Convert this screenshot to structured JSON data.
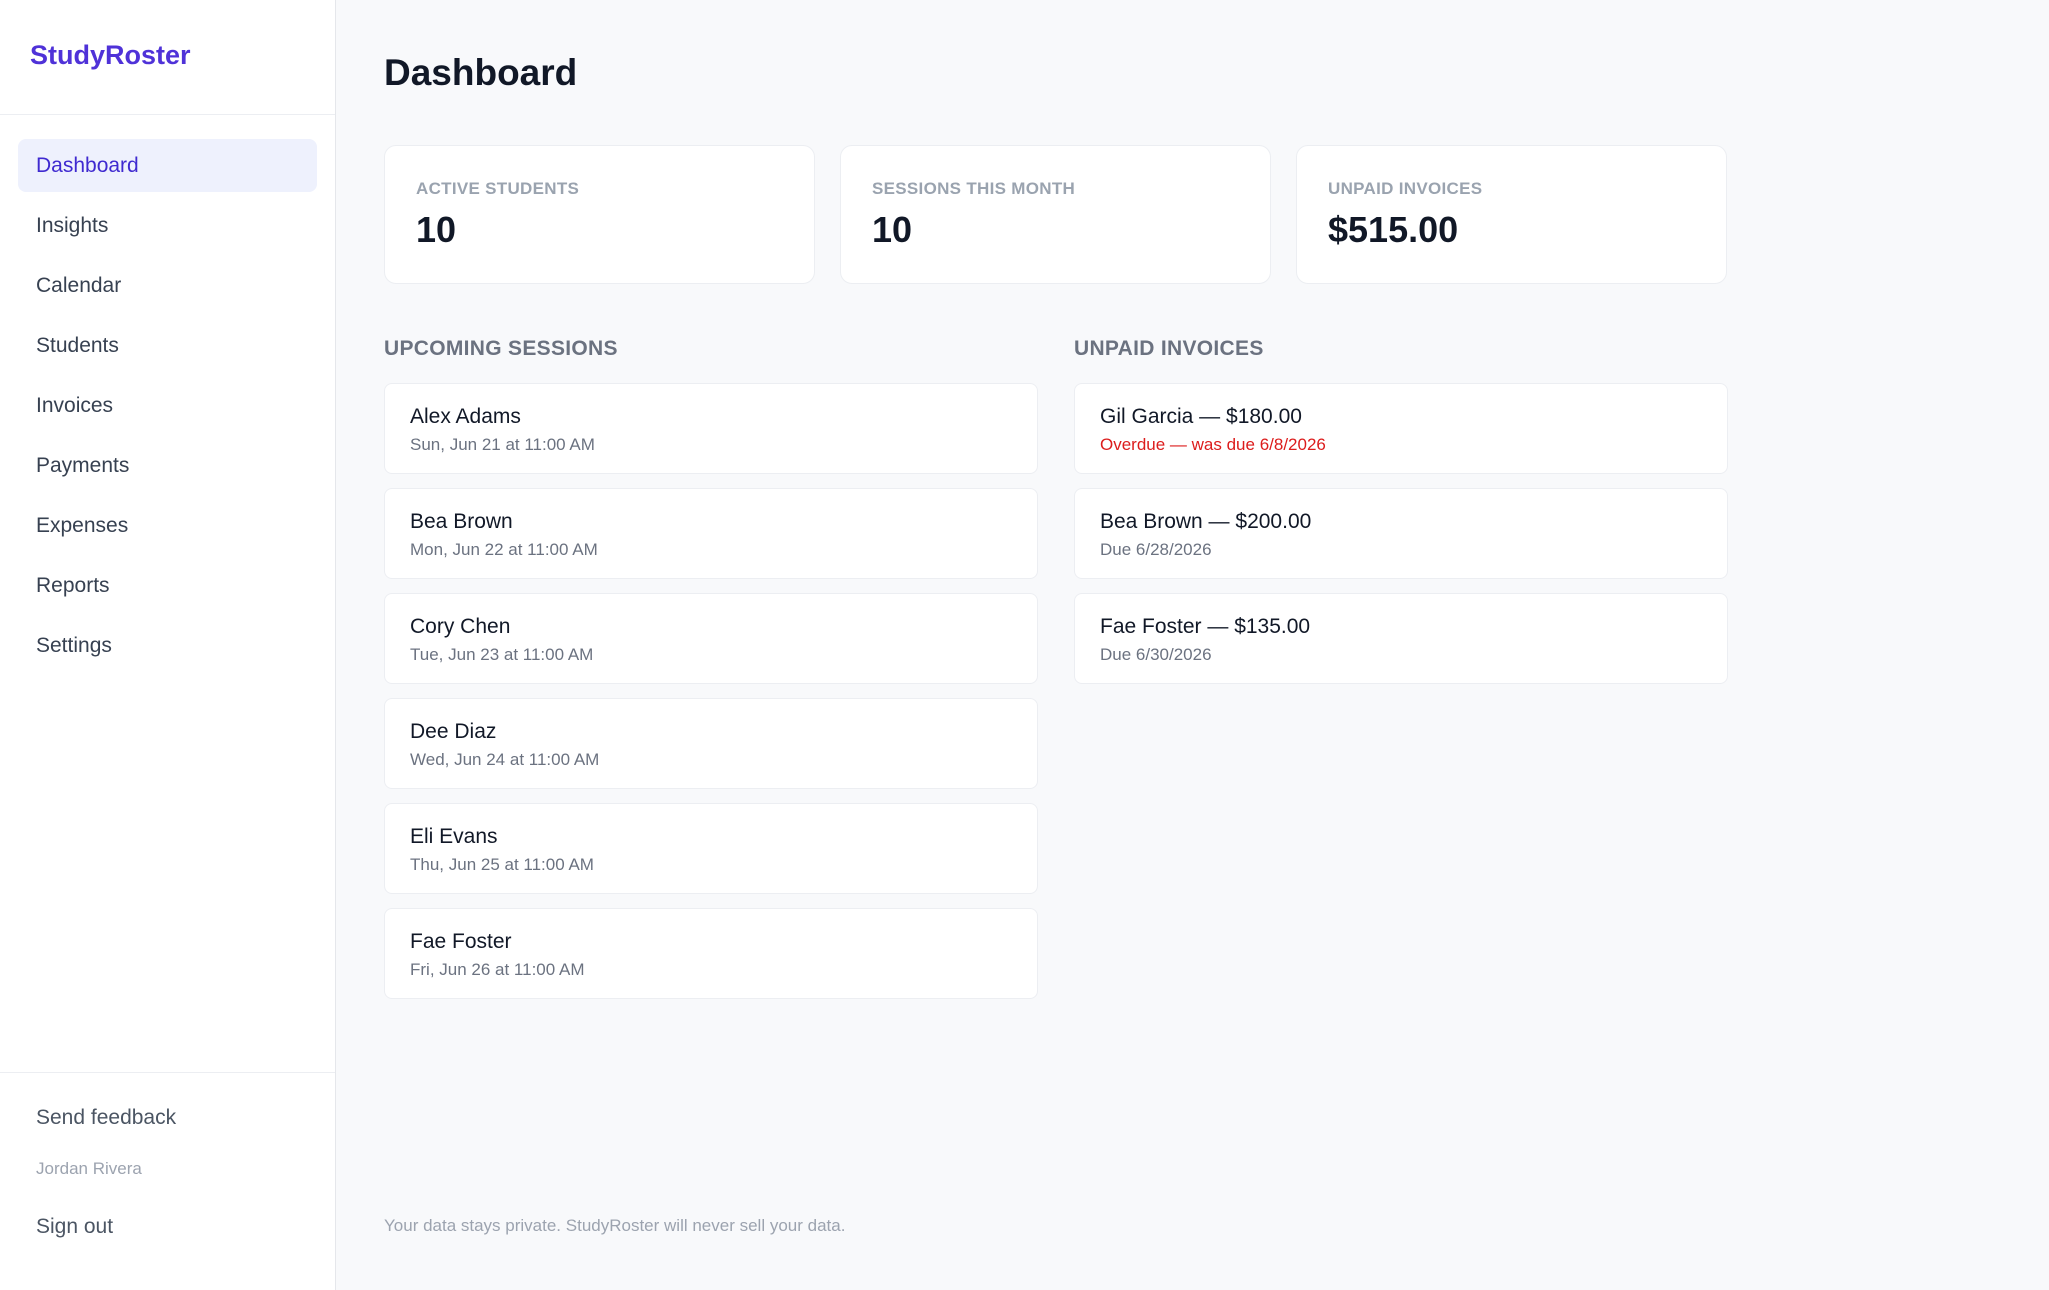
{
  "app": {
    "brand": "StudyRoster"
  },
  "sidebar": {
    "items": [
      {
        "label": "Dashboard",
        "active": true
      },
      {
        "label": "Insights"
      },
      {
        "label": "Calendar"
      },
      {
        "label": "Students"
      },
      {
        "label": "Invoices"
      },
      {
        "label": "Payments"
      },
      {
        "label": "Expenses"
      },
      {
        "label": "Reports"
      },
      {
        "label": "Settings"
      }
    ],
    "footer": {
      "feedback": "Send feedback",
      "user_name": "Jordan Rivera",
      "sign_out": "Sign out"
    }
  },
  "main": {
    "title": "Dashboard",
    "stats": [
      {
        "label": "Active students",
        "value": "10"
      },
      {
        "label": "Sessions this month",
        "value": "10"
      },
      {
        "label": "Unpaid invoices",
        "value": "$515.00"
      }
    ],
    "upcoming": {
      "title": "Upcoming sessions",
      "items": [
        {
          "name": "Alex Adams",
          "when": "Sun, Jun 21 at 11:00 AM"
        },
        {
          "name": "Bea Brown",
          "when": "Mon, Jun 22 at 11:00 AM"
        },
        {
          "name": "Cory Chen",
          "when": "Tue, Jun 23 at 11:00 AM"
        },
        {
          "name": "Dee Diaz",
          "when": "Wed, Jun 24 at 11:00 AM"
        },
        {
          "name": "Eli Evans",
          "when": "Thu, Jun 25 at 11:00 AM"
        },
        {
          "name": "Fae Foster",
          "when": "Fri, Jun 26 at 11:00 AM"
        }
      ]
    },
    "unpaid": {
      "title": "Unpaid invoices",
      "items": [
        {
          "title": "Gil Garcia — $180.00",
          "status": "Overdue — was due 6/8/2026",
          "overdue": true
        },
        {
          "title": "Bea Brown — $200.00",
          "status": "Due 6/28/2026"
        },
        {
          "title": "Fae Foster — $135.00",
          "status": "Due 6/30/2026"
        }
      ]
    },
    "privacy_note": "Your data stays private. StudyRoster will never sell your data."
  },
  "colors": {
    "brand": "#4f32d8",
    "active_nav_bg": "#eef1fd",
    "overdue": "#dc1c1c"
  }
}
